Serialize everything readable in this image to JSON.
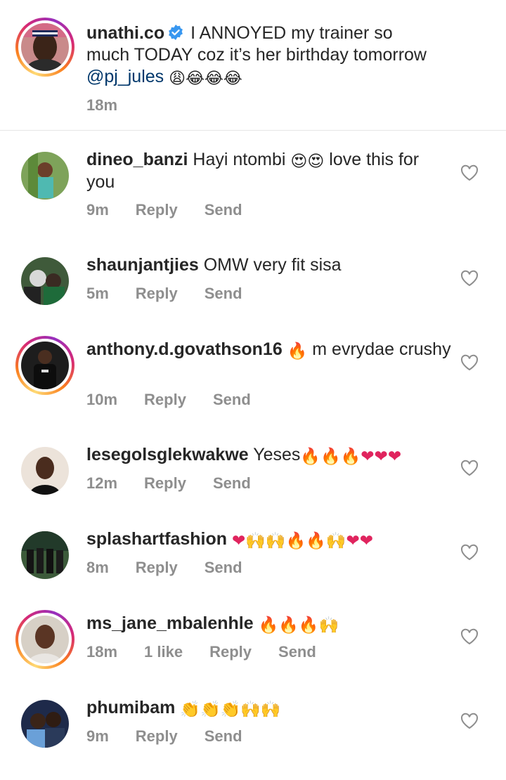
{
  "caption": {
    "username": "unathi.co",
    "text_line1": "I ANNOYED my trainer so",
    "text_line2": "much TODAY coz it’s her birthday tomorrow",
    "mention": "@pj_jules",
    "emojis": "😩😂😂😂",
    "time": "18m"
  },
  "comments": [
    {
      "username": "dineo_banzi",
      "text": "Hayi ntombi",
      "emojis": "😍😍",
      "text_after": "love this for you",
      "time": "9m",
      "likes": "",
      "reply": "Reply",
      "send": "Send"
    },
    {
      "username": "shaunjantjies",
      "text": "OMW very fit sisa",
      "emojis": "",
      "text_after": "",
      "time": "5m",
      "likes": "",
      "reply": "Reply",
      "send": "Send"
    },
    {
      "username": "anthony.d.govathson16",
      "text": "",
      "emojis": "🔥",
      "text_after": "m evrydae crushy",
      "time": "10m",
      "likes": "",
      "reply": "Reply",
      "send": "Send"
    },
    {
      "username": "lesegolsglekwakwe",
      "text": "Yeses",
      "emojis": "🔥🔥🔥❤❤❤",
      "text_after": "",
      "time": "12m",
      "likes": "",
      "reply": "Reply",
      "send": "Send"
    },
    {
      "username": "splashartfashion",
      "text": "",
      "emojis": "❤🙌🙌🔥🔥🙌❤❤",
      "text_after": "",
      "time": "8m",
      "likes": "",
      "reply": "Reply",
      "send": "Send"
    },
    {
      "username": "ms_jane_mbalenhle",
      "text": "",
      "emojis": "🔥🔥🔥🙌",
      "text_after": "",
      "time": "18m",
      "likes": "1 like",
      "reply": "Reply",
      "send": "Send"
    },
    {
      "username": "phumibam",
      "text": "",
      "emojis": "👏👏👏🙌🙌",
      "text_after": "",
      "time": "9m",
      "likes": "",
      "reply": "Reply",
      "send": "Send"
    }
  ],
  "colors": {
    "text": "#262626",
    "meta": "#8e8e8e",
    "mention": "#00376b",
    "verified": "#3897f0",
    "divider": "#e6e6e6"
  }
}
